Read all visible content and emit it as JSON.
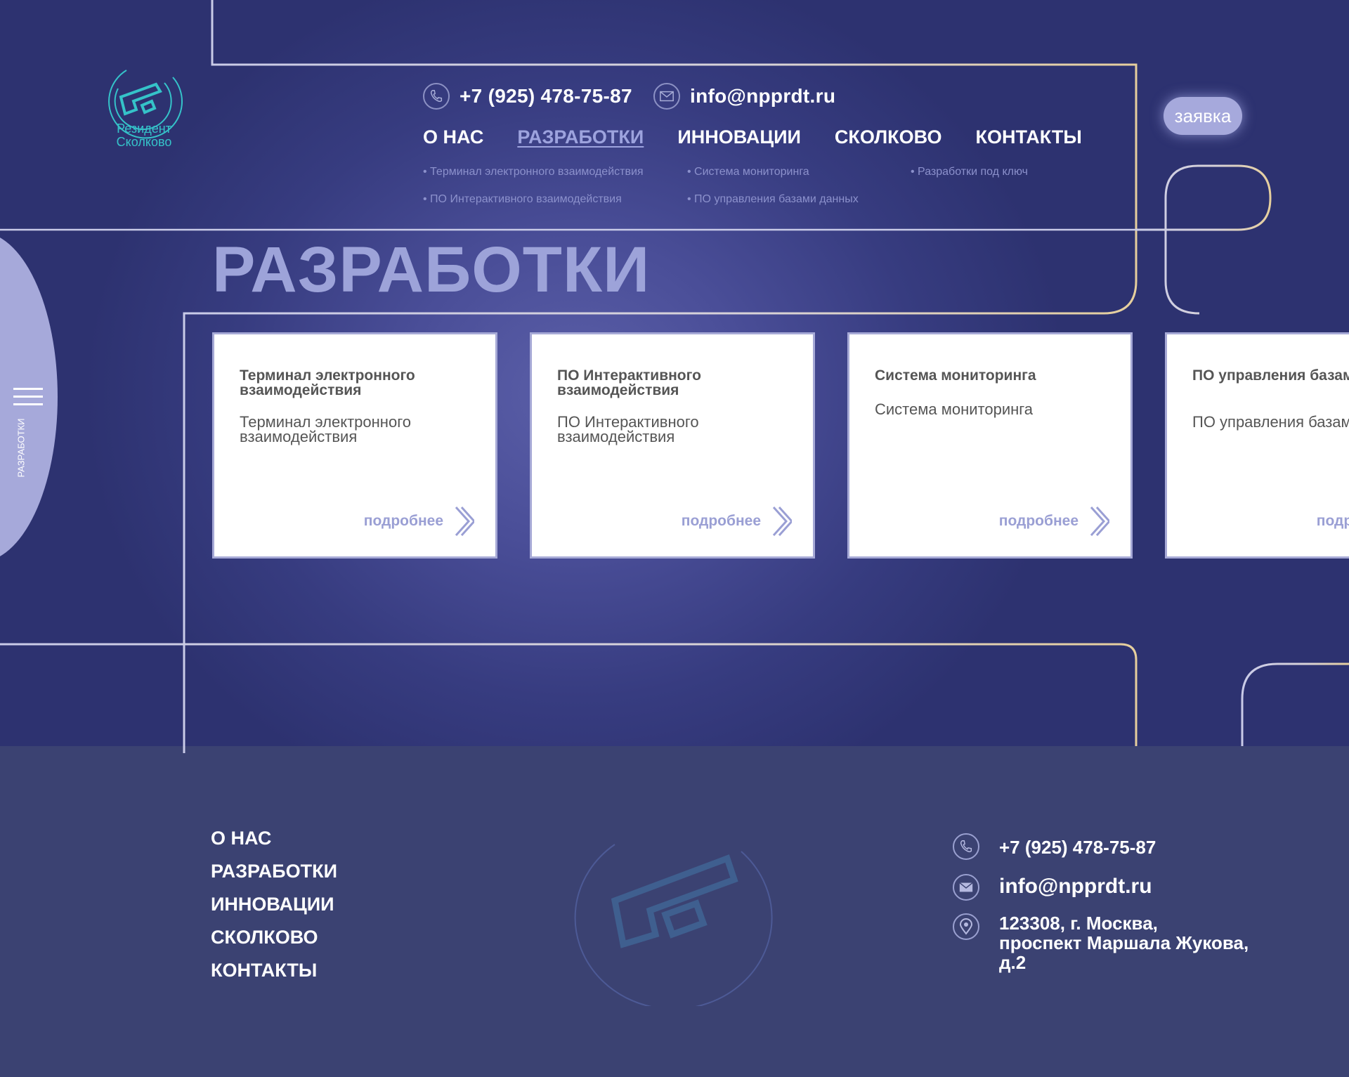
{
  "header": {
    "logo_text_line1": "Резидент",
    "logo_text_line2": "Сколково",
    "phone": "+7 (925) 478-75-87",
    "email": "info@npprdt.ru",
    "request_button": "заявка"
  },
  "nav": {
    "items": [
      {
        "label": "О НАС",
        "active": false
      },
      {
        "label": "РАЗРАБОТКИ",
        "active": true
      },
      {
        "label": "ИННОВАЦИИ",
        "active": false
      },
      {
        "label": "СКОЛКОВО",
        "active": false
      },
      {
        "label": "КОНТАКТЫ",
        "active": false
      }
    ],
    "submenu": [
      "• Терминал электронного взаимодействия",
      "• Система мониторинга",
      "• Разработки под ключ",
      "• ПО Интерактивного взаимодействия",
      "• ПО управления базами данных"
    ]
  },
  "page": {
    "title": "РАЗРАБОТКИ",
    "side_label": "РАЗРАБОТКИ"
  },
  "cards": [
    {
      "title": "Терминал электронного взаимодействия",
      "description": "Терминал электронного взаимодействия",
      "more": "подробнее"
    },
    {
      "title": "ПО Интерактивного взаимодействия",
      "description": "ПО Интерактивного взаимодействия",
      "more": "подробнее"
    },
    {
      "title": "Система мониторинга",
      "description": "Система мониторинга",
      "more": "подробнее"
    },
    {
      "title": "ПО управления базами данных",
      "description": "ПО управления базами данных",
      "more": "подробнее"
    }
  ],
  "footer": {
    "nav": [
      "О НАС",
      "РАЗРАБОТКИ",
      "ИННОВАЦИИ",
      "СКОЛКОВО",
      "КОНТАКТЫ"
    ],
    "phone": "+7 (925) 478-75-87",
    "email": "info@npprdt.ru",
    "address_line1": "123308, г. Москва,",
    "address_line2": "проспект Маршала Жукова,",
    "address_line3": "д.2"
  },
  "colors": {
    "accent": "#a6a9da",
    "logo": "#35c3c9",
    "hero_bg": "#4a4e98",
    "footer_bg": "#3b4272"
  }
}
